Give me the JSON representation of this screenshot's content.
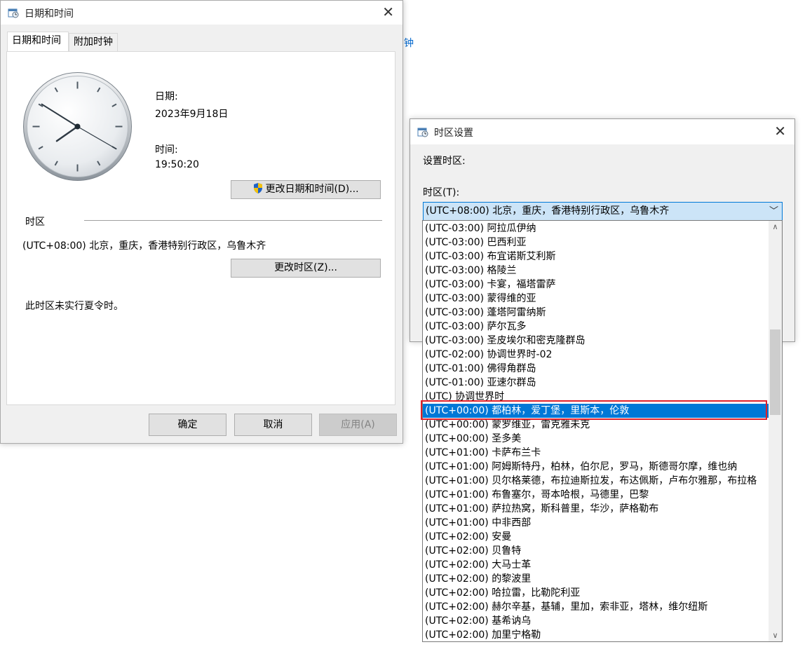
{
  "background": {
    "link_fragment": "钟"
  },
  "main_dialog": {
    "title": "日期和时间",
    "tabs": [
      {
        "label": "日期和时间"
      },
      {
        "label": "附加时钟"
      }
    ],
    "date_label": "日期:",
    "date_value": "2023年9月18日",
    "time_label": "时间:",
    "time_value": "19:50:20",
    "change_datetime_button": "更改日期和时间(D)...",
    "timezone_section": "时区",
    "timezone_value": "(UTC+08:00) 北京，重庆，香港特别行政区，乌鲁木齐",
    "change_timezone_button": "更改时区(Z)...",
    "dst_note": "此时区未实行夏令时。",
    "ok_button": "确定",
    "cancel_button": "取消",
    "apply_button": "应用(A)"
  },
  "tz_dialog": {
    "title": "时区设置",
    "set_label": "设置时区:",
    "combo_label": "时区(T):",
    "combo_value": "(UTC+08:00) 北京，重庆，香港特别行政区，乌鲁木齐",
    "items": [
      "(UTC-03:00) 阿拉瓜伊纳",
      "(UTC-03:00) 巴西利亚",
      "(UTC-03:00) 布宜诺斯艾利斯",
      "(UTC-03:00) 格陵兰",
      "(UTC-03:00) 卡宴，福塔雷萨",
      "(UTC-03:00) 蒙得维的亚",
      "(UTC-03:00) 蓬塔阿雷纳斯",
      "(UTC-03:00) 萨尔瓦多",
      "(UTC-03:00) 圣皮埃尔和密克隆群岛",
      "(UTC-02:00) 协调世界时-02",
      "(UTC-01:00) 佛得角群岛",
      "(UTC-01:00) 亚速尔群岛",
      "(UTC) 协调世界时",
      "(UTC+00:00) 都柏林，爱丁堡，里斯本，伦敦",
      "(UTC+00:00) 蒙罗维亚，雷克雅未克",
      "(UTC+00:00) 圣多美",
      "(UTC+01:00) 卡萨布兰卡",
      "(UTC+01:00) 阿姆斯特丹，柏林，伯尔尼，罗马，斯德哥尔摩，维也纳",
      "(UTC+01:00) 贝尔格莱德，布拉迪斯拉发，布达佩斯，卢布尔雅那，布拉格",
      "(UTC+01:00) 布鲁塞尔，哥本哈根，马德里，巴黎",
      "(UTC+01:00) 萨拉热窝，斯科普里，华沙，萨格勒布",
      "(UTC+01:00) 中非西部",
      "(UTC+02:00) 安曼",
      "(UTC+02:00) 贝鲁特",
      "(UTC+02:00) 大马士革",
      "(UTC+02:00) 的黎波里",
      "(UTC+02:00) 哈拉雷，比勒陀利亚",
      "(UTC+02:00) 赫尔辛基，基辅，里加，索非亚，塔林，维尔纽斯",
      "(UTC+02:00) 基希讷乌",
      "(UTC+02:00) 加里宁格勒"
    ],
    "selected_index": 13,
    "colors": {
      "selection": "#0078d7",
      "highlight_outline": "#e0202a"
    }
  },
  "clock": {
    "hours": 19,
    "minutes": 50,
    "seconds": 20
  }
}
